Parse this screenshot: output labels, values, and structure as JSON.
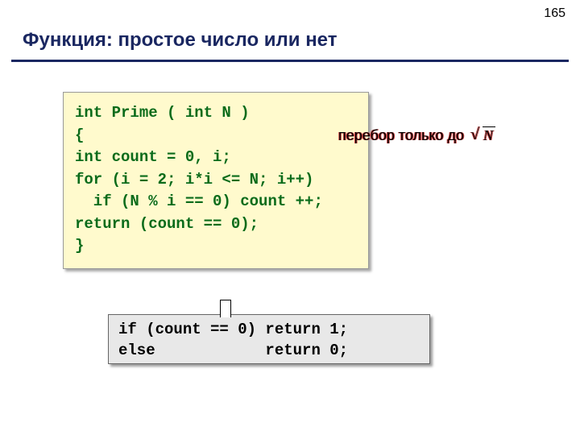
{
  "page_number": "165",
  "title": "Функция: простое число или нет",
  "code_block_1": "int Prime ( int N )\n{\nint count = 0, i;\nfor (i = 2; i*i <= N; i++)\n  if (N % i == 0) count ++;\nreturn (count == 0);\n}",
  "annotation_text": "перебор только до",
  "annotation_sqrt": "N",
  "code_block_2": "if (count == 0) return 1;\nelse            return 0;"
}
